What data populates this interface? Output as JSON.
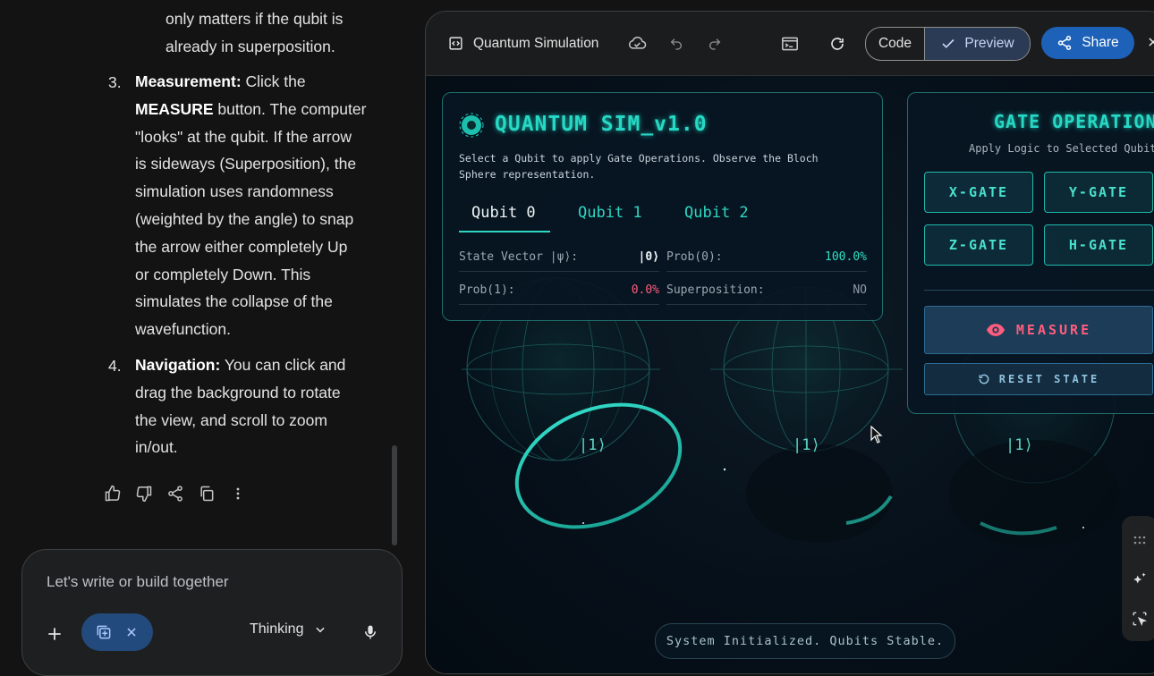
{
  "chat": {
    "paragraph_tail_line1": "only matters if the qubit is",
    "paragraph_tail_line2": "already in superposition.",
    "item3": {
      "number": "3.",
      "lines": [
        {
          "bold": "Measurement:",
          "text": " Click the"
        },
        {
          "bold": "MEASURE",
          "text": " button. The computer"
        },
        {
          "bold": "",
          "text": "\"looks\" at the qubit. If the arrow"
        },
        {
          "bold": "",
          "text": "is sideways (Superposition), the"
        },
        {
          "bold": "",
          "text": "simulation uses randomness"
        },
        {
          "bold": "",
          "text": "(weighted by the angle) to snap"
        },
        {
          "bold": "",
          "text": "the arrow either completely Up"
        },
        {
          "bold": "",
          "text": "or completely Down. This"
        },
        {
          "bold": "",
          "text": "simulates the collapse of the"
        },
        {
          "bold": "",
          "text": "wavefunction."
        }
      ]
    },
    "item4": {
      "number": "4.",
      "lines": [
        {
          "bold": "Navigation:",
          "text": " You can click and"
        },
        {
          "bold": "",
          "text": "drag the background to rotate"
        },
        {
          "bold": "",
          "text": "the view, and scroll to zoom"
        },
        {
          "bold": "",
          "text": "in/out."
        }
      ]
    },
    "actions": [
      "thumbs-up-icon",
      "thumbs-down-icon",
      "share-icon",
      "copy-icon",
      "more-vert-icon"
    ],
    "composer": {
      "placeholder": "Let's write or build together",
      "mode_label": "Thinking"
    }
  },
  "preview": {
    "title": "Quantum Simulation",
    "code_label": "Code",
    "preview_label": "Preview",
    "share_label": "Share"
  },
  "sim": {
    "title": "QUANTUM SIM_v1.0",
    "description": "Select a Qubit to apply Gate Operations. Observe the Bloch Sphere representation.",
    "tabs": [
      "Qubit 0",
      "Qubit 1",
      "Qubit 2"
    ],
    "active_tab": "Qubit 0",
    "state_vector_label": "State Vector |ψ⟩:",
    "state_vector_value": "|0⟩",
    "prob0_label": "Prob(0):",
    "prob0_value": "100.0%",
    "prob1_label": "Prob(1):",
    "prob1_value": "0.0%",
    "superposition_label": "Superposition:",
    "superposition_value": "NO",
    "gates_title": "GATE OPERATIONS",
    "gates_subtitle": "Apply Logic to Selected Qubit",
    "gate_buttons": [
      "X-GATE",
      "Y-GATE",
      "Z-GATE",
      "H-GATE"
    ],
    "measure_label": "MEASURE",
    "reset_label": "RESET STATE",
    "ket_labels": [
      "|1⟩",
      "|1⟩",
      "|1⟩"
    ],
    "status": "System Initialized. Qubits Stable."
  },
  "colors": {
    "accent_teal": "#27d8c4",
    "measure_pink": "#ff5d7d",
    "share_blue": "#1d62b8",
    "background": "#131314"
  }
}
